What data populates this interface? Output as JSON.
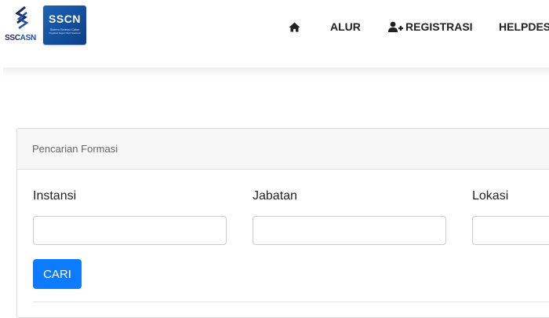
{
  "header": {
    "logo_left_text": "SSC",
    "logo_left_text_accent": "ASN",
    "logo_right_title": "SSCN",
    "logo_right_subtitle": "Sistem Seleksi Calon",
    "logo_right_subtitle2": "Pegawai Negeri Sipil Nasional"
  },
  "nav": {
    "items": [
      {
        "label": "",
        "icon": "home-icon"
      },
      {
        "label": "ALUR"
      },
      {
        "label": "REGISTRASI",
        "icon": "user-plus-icon"
      },
      {
        "label": "HELPDES"
      }
    ]
  },
  "search": {
    "card_title": "Pencarian Formasi",
    "fields": [
      {
        "label": "Instansi",
        "value": ""
      },
      {
        "label": "Jabatan",
        "value": ""
      },
      {
        "label": "Lokasi",
        "value": ""
      }
    ],
    "button_label": "CARI"
  },
  "colors": {
    "primary": "#0d7bff",
    "brand_dark": "#1d2a5c",
    "brand_blue": "#1b64b8"
  }
}
